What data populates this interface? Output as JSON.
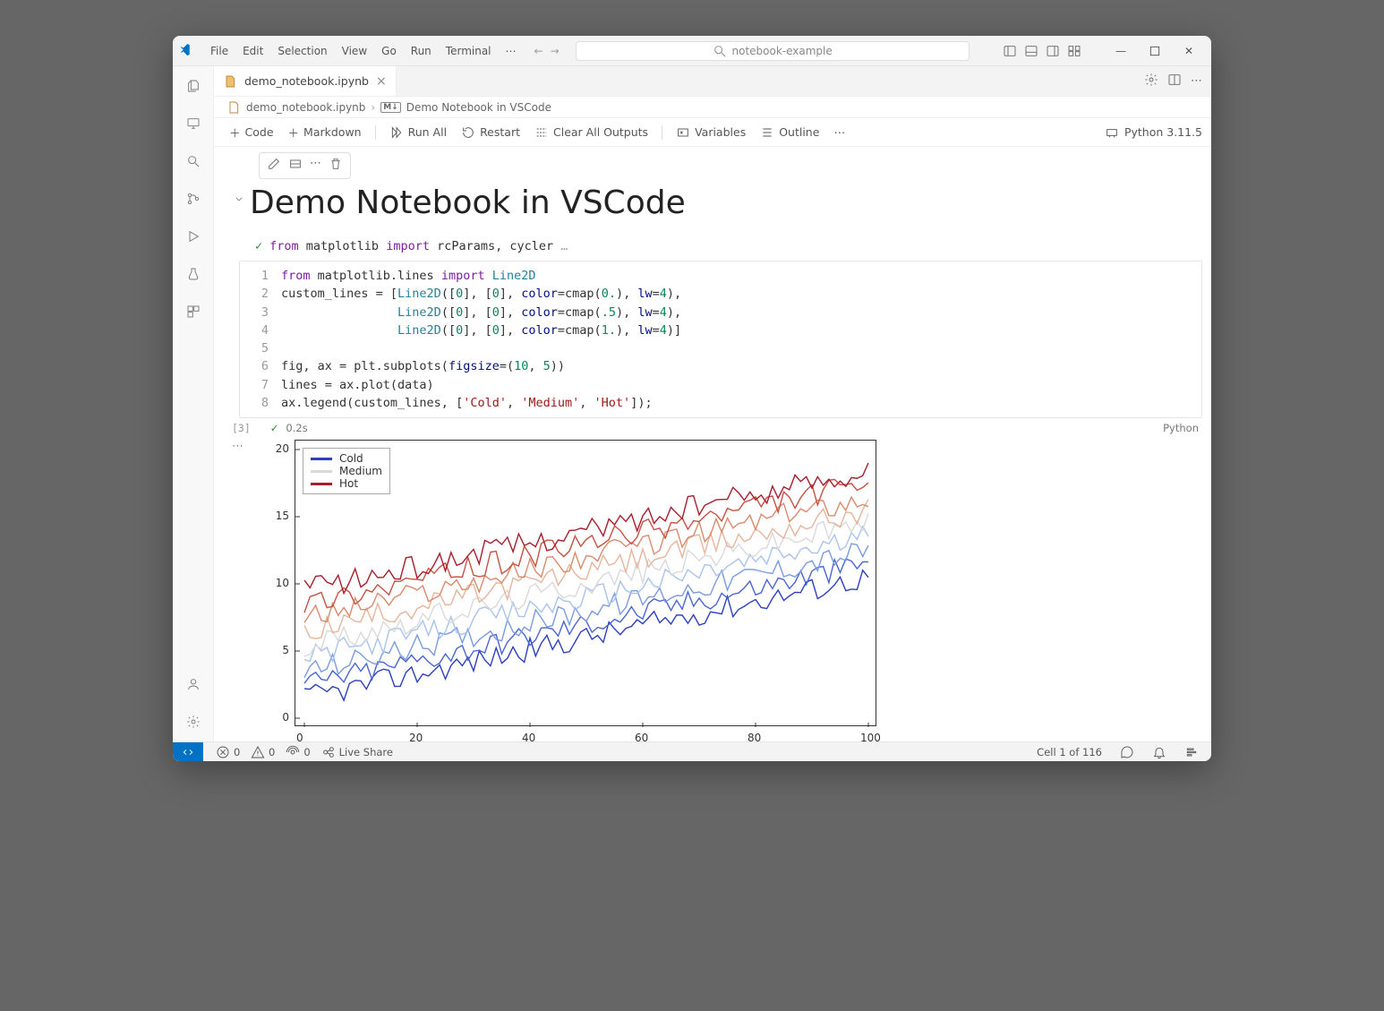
{
  "menus": [
    "File",
    "Edit",
    "Selection",
    "View",
    "Go",
    "Run",
    "Terminal"
  ],
  "search_placeholder": "notebook-example",
  "tab": {
    "filename": "demo_notebook.ipynb"
  },
  "breadcrumb": {
    "file": "demo_notebook.ipynb",
    "cell": "Demo Notebook in VSCode"
  },
  "toolbar": {
    "code": "Code",
    "markdown": "Markdown",
    "run_all": "Run All",
    "restart": "Restart",
    "clear": "Clear All Outputs",
    "variables": "Variables",
    "outline": "Outline",
    "kernel": "Python 3.11.5"
  },
  "heading": "Demo Notebook in VSCode",
  "import_line": {
    "pre": "from ",
    "mod": "matplotlib ",
    "imp": "import ",
    "rest": "rcParams, cycler",
    "ell": "…"
  },
  "code": {
    "l1": {
      "pre": "from ",
      "mod": "matplotlib.lines ",
      "imp": "import ",
      "cls": "Line2D"
    },
    "l2a": "custom_lines = [",
    "l2b": "Line2D",
    "l2c": "([",
    "l2d": "0",
    "l2e": "], [",
    "l2f": "0",
    "l2g": "], ",
    "l2h": "color",
    "l2i": "=cmap(",
    "l2j": "0.",
    "l2k": "), ",
    "l2l": "lw",
    "l2m": "=",
    "l2n": "4",
    "l2o": "),",
    "pad": "                ",
    "l3j": ".5",
    "l4j": "1.",
    "l4o": ")]",
    "l6": "fig, ax = plt.subplots(",
    "l6a": "figsize",
    "l6b": "=(",
    "l6c": "10",
    "l6d": ", ",
    "l6e": "5",
    "l6f": "))",
    "l7": "lines = ax.plot(data)",
    "l8a": "ax.legend(custom_lines, [",
    "l8b": "'Cold'",
    "l8c": ", ",
    "l8d": "'Medium'",
    "l8e": ", ",
    "l8f": "'Hot'",
    "l8g": "]);"
  },
  "exec": {
    "count": "[3]",
    "time": "0.2s",
    "lang": "Python"
  },
  "chart_data": {
    "type": "line",
    "legend": [
      "Cold",
      "Medium",
      "Hot"
    ],
    "legend_colors": [
      "#2b3fbf",
      "#d9d9d9",
      "#a81d2a"
    ],
    "series_colors": [
      "#2b3fbf",
      "#4a66d0",
      "#7a9be0",
      "#a8c3ee",
      "#d9d9d9",
      "#e6b49a",
      "#d98a6a",
      "#c65242",
      "#a81d2a"
    ],
    "x_range": [
      0,
      100
    ],
    "y_ticks": [
      0,
      5,
      10,
      15,
      20
    ],
    "x_ticks": [
      0,
      20,
      40,
      60,
      80,
      100
    ],
    "n_series": 9,
    "base_offsets": [
      1.5,
      2.5,
      3.5,
      4.5,
      5.5,
      6.5,
      7.5,
      8.5,
      9.5
    ],
    "growth": 0.09,
    "noise_amp": 0.9
  },
  "status": {
    "errors": "0",
    "warnings": "0",
    "ports": "0",
    "live": "Live Share",
    "cell": "Cell 1 of 116"
  }
}
